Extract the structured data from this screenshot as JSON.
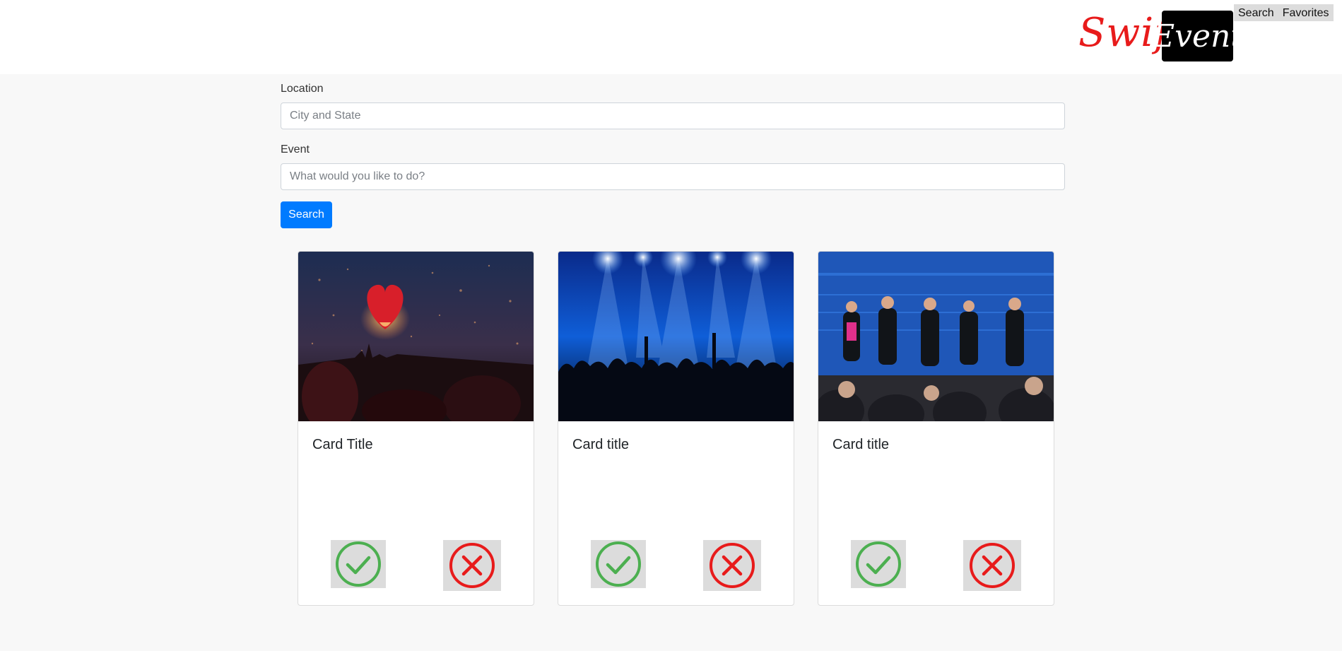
{
  "header": {
    "logo_part1": "Swift",
    "logo_part2": "Event",
    "nav": [
      "Search",
      "Favorites"
    ]
  },
  "form": {
    "location_label": "Location",
    "location_placeholder": "City and State",
    "event_label": "Event",
    "event_placeholder": "What would you like to do?",
    "search_button": "Search"
  },
  "cards": [
    {
      "title": "Card Title",
      "image": "lanterns-photo"
    },
    {
      "title": "Card title",
      "image": "concert-photo"
    },
    {
      "title": "Card title",
      "image": "panel-discussion-photo"
    }
  ],
  "colors": {
    "accent": "#007bff",
    "logo_red": "#e81b1b",
    "check_green": "#4caf50",
    "cross_red": "#e81b1b"
  }
}
